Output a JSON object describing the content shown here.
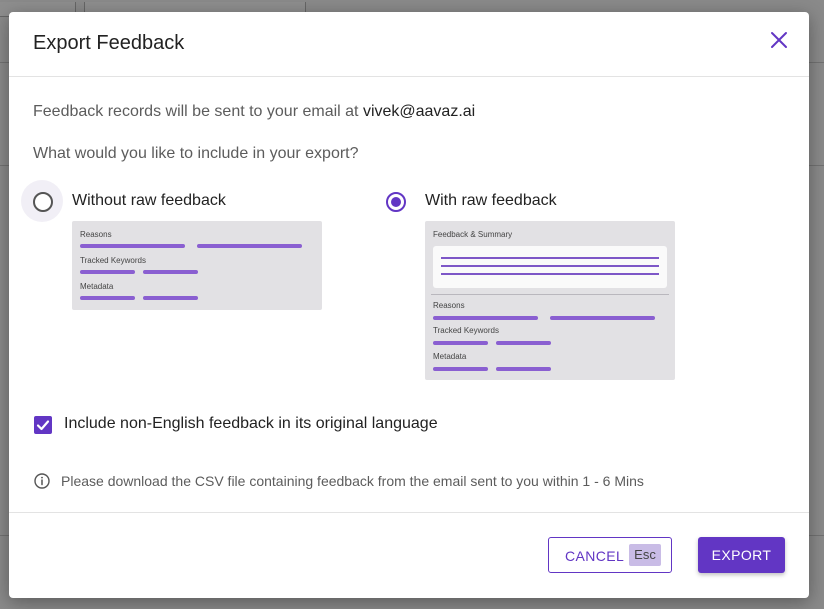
{
  "modal": {
    "title": "Export Feedback",
    "email_prefix": "Feedback records will be sent to your email at",
    "email": "vivek@aavaz.ai",
    "question": "What would you like to include in your export?",
    "options": [
      {
        "label": "Without raw feedback",
        "selected": false,
        "preview": {
          "sections": [
            "Reasons",
            "Tracked Keywords",
            "Metadata"
          ]
        }
      },
      {
        "label": "With raw feedback",
        "selected": true,
        "preview": {
          "sections": [
            "Feedback & Summary",
            "Reasons",
            "Tracked Keywords",
            "Metadata"
          ]
        }
      }
    ],
    "include_non_english": {
      "label": "Include non-English feedback in its original language",
      "checked": true
    },
    "info_text": "Please download the CSV file containing feedback from the email sent to you within 1 - 6 Mins",
    "cancel_label": "CANCEL",
    "cancel_shortcut": "Esc",
    "export_label": "EXPORT"
  },
  "icons": {
    "close": "close-icon",
    "info": "info-icon",
    "check": "checkmark-icon"
  },
  "colors": {
    "accent": "#6236c4",
    "preview_bar": "#8a5fd1",
    "preview_bg": "#e2e1e4",
    "overlay": "#7a7a7a"
  }
}
